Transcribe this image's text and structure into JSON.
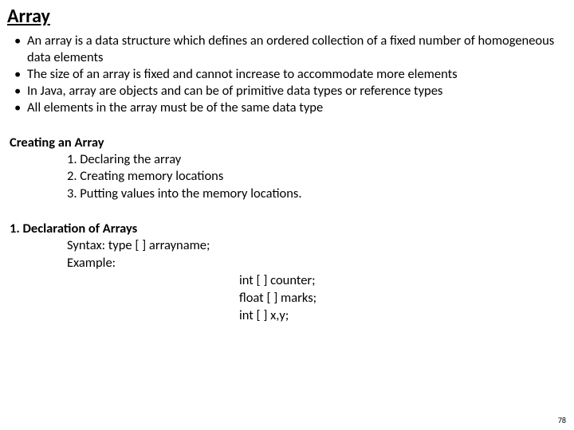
{
  "title": "Array",
  "bullets": [
    "An array is a data structure which defines an ordered collection of a fixed number of homogeneous data elements",
    "The size of an array is fixed and cannot increase to accommodate more elements",
    "In Java, array are objects and can be of primitive data types or reference types",
    "All elements in the array must be of the same data type"
  ],
  "creating": {
    "heading": "Creating an Array",
    "steps": [
      "1. Declaring the array",
      "2. Creating memory locations",
      "3. Putting values into the memory locations."
    ]
  },
  "declaration": {
    "heading": "1. Declaration of Arrays",
    "syntax_line": "Syntax:   type [ ] arrayname;",
    "example_label": "Example:",
    "examples": [
      "int [ ] counter;",
      "float [ ] marks;",
      "int [ ] x,y;"
    ]
  },
  "page_number": "78"
}
